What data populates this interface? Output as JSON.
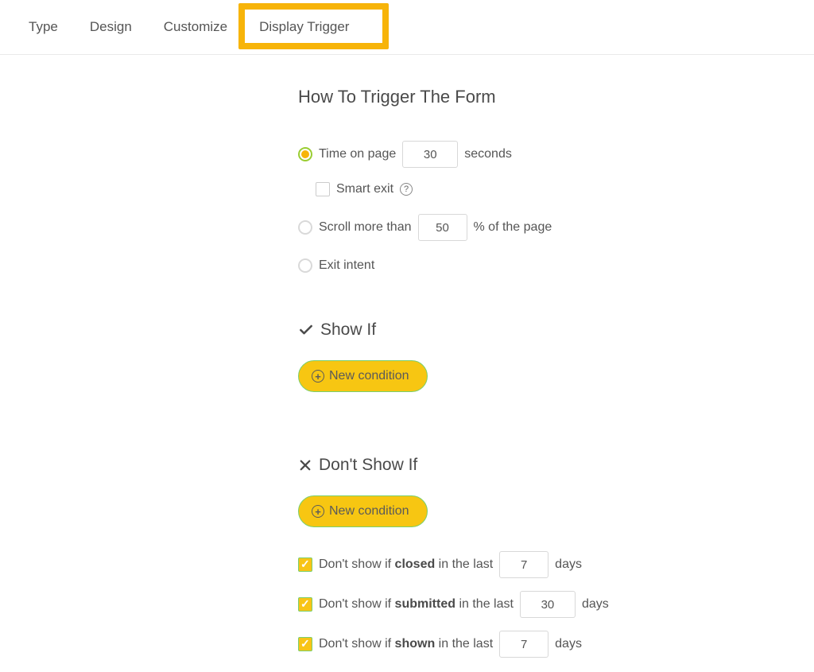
{
  "tabs": {
    "type": "Type",
    "design": "Design",
    "customize": "Customize",
    "display_trigger": "Display Trigger"
  },
  "section": {
    "title": "How To Trigger The Form"
  },
  "triggers": {
    "time_on_page": {
      "label_before": "Time on page",
      "value": "30",
      "label_after": "seconds"
    },
    "smart_exit": {
      "label": "Smart exit"
    },
    "scroll": {
      "label_before": "Scroll more than",
      "value": "50",
      "label_after": "% of the page"
    },
    "exit_intent": {
      "label": "Exit intent"
    }
  },
  "show_if": {
    "title": "Show If",
    "new_condition": "New condition"
  },
  "dont_show_if": {
    "title": "Don't Show If",
    "new_condition": "New condition",
    "rules": {
      "closed": {
        "prefix": "Don't show if ",
        "bold": "closed",
        "mid": " in the last",
        "value": "7",
        "suffix": "days"
      },
      "submitted": {
        "prefix": "Don't show if ",
        "bold": "submitted",
        "mid": " in the last",
        "value": "30",
        "suffix": "days"
      },
      "shown": {
        "prefix": "Don't show if ",
        "bold": "shown",
        "mid": " in the last",
        "value": "7",
        "suffix": "days"
      }
    }
  }
}
